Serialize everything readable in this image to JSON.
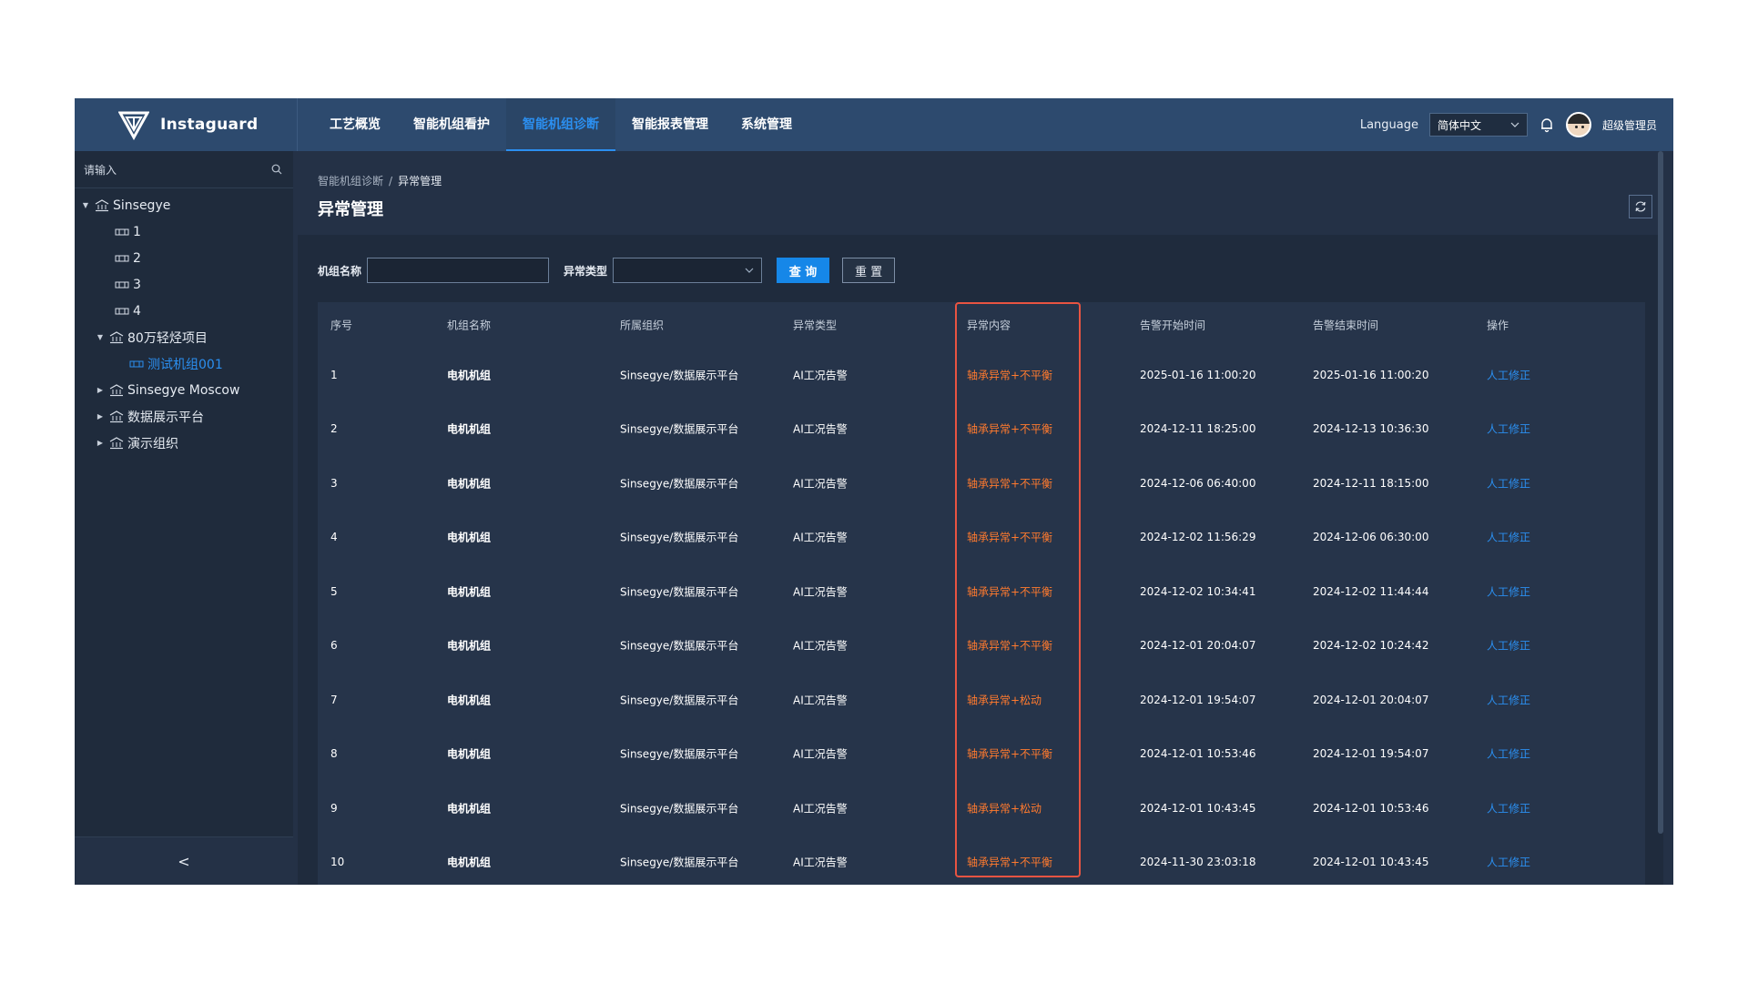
{
  "app": {
    "brand": "Instaguard"
  },
  "nav": {
    "items": [
      {
        "label": "工艺概览",
        "active": false
      },
      {
        "label": "智能机组看护",
        "active": false
      },
      {
        "label": "智能机组诊断",
        "active": true
      },
      {
        "label": "智能报表管理",
        "active": false
      },
      {
        "label": "系统管理",
        "active": false
      }
    ]
  },
  "header_tools": {
    "language_label": "Language",
    "language_value": "简体中文",
    "user_name": "超级管理员"
  },
  "sidebar": {
    "search_placeholder": "请输入",
    "tree": [
      {
        "label": "Sinsegye",
        "type": "org",
        "expanded": true
      },
      {
        "label": "1",
        "type": "unit"
      },
      {
        "label": "2",
        "type": "unit"
      },
      {
        "label": "3",
        "type": "unit"
      },
      {
        "label": "4",
        "type": "unit"
      },
      {
        "label": "80万轻烃项目",
        "type": "org",
        "expanded": true
      },
      {
        "label": "测试机组001",
        "type": "unit",
        "selected": true
      },
      {
        "label": "Sinsegye Moscow",
        "type": "org",
        "expanded": false
      },
      {
        "label": "数据展示平台",
        "type": "org",
        "expanded": false
      },
      {
        "label": "演示组织",
        "type": "org",
        "expanded": false
      }
    ],
    "collapse_glyph": "<"
  },
  "page": {
    "breadcrumb": [
      "智能机组诊断",
      "异常管理"
    ],
    "breadcrumb_sep": "/",
    "title": "异常管理"
  },
  "filters": {
    "unit_name_label": "机组名称",
    "unit_name_value": "",
    "anomaly_type_label": "异常类型",
    "anomaly_type_value": "",
    "query_label": "查 询",
    "reset_label": "重 置"
  },
  "table": {
    "columns": [
      "序号",
      "机组名称",
      "所属组织",
      "异常类型",
      "异常内容",
      "告警开始时间",
      "告警结束时间",
      "操作"
    ],
    "rows": [
      [
        "1",
        "电机机组",
        "Sinsegye/数据展示平台",
        "AI工况告警",
        "轴承异常+不平衡",
        "2025-01-16 11:00:20",
        "2025-01-16 11:00:20",
        "人工修正"
      ],
      [
        "2",
        "电机机组",
        "Sinsegye/数据展示平台",
        "AI工况告警",
        "轴承异常+不平衡",
        "2024-12-11 18:25:00",
        "2024-12-13 10:36:30",
        "人工修正"
      ],
      [
        "3",
        "电机机组",
        "Sinsegye/数据展示平台",
        "AI工况告警",
        "轴承异常+不平衡",
        "2024-12-06 06:40:00",
        "2024-12-11 18:15:00",
        "人工修正"
      ],
      [
        "4",
        "电机机组",
        "Sinsegye/数据展示平台",
        "AI工况告警",
        "轴承异常+不平衡",
        "2024-12-02 11:56:29",
        "2024-12-06 06:30:00",
        "人工修正"
      ],
      [
        "5",
        "电机机组",
        "Sinsegye/数据展示平台",
        "AI工况告警",
        "轴承异常+不平衡",
        "2024-12-02 10:34:41",
        "2024-12-02 11:44:44",
        "人工修正"
      ],
      [
        "6",
        "电机机组",
        "Sinsegye/数据展示平台",
        "AI工况告警",
        "轴承异常+不平衡",
        "2024-12-01 20:04:07",
        "2024-12-02 10:24:42",
        "人工修正"
      ],
      [
        "7",
        "电机机组",
        "Sinsegye/数据展示平台",
        "AI工况告警",
        "轴承异常+松动",
        "2024-12-01 19:54:07",
        "2024-12-01 20:04:07",
        "人工修正"
      ],
      [
        "8",
        "电机机组",
        "Sinsegye/数据展示平台",
        "AI工况告警",
        "轴承异常+不平衡",
        "2024-12-01 10:53:46",
        "2024-12-01 19:54:07",
        "人工修正"
      ],
      [
        "9",
        "电机机组",
        "Sinsegye/数据展示平台",
        "AI工况告警",
        "轴承异常+松动",
        "2024-12-01 10:43:45",
        "2024-12-01 10:53:46",
        "人工修正"
      ],
      [
        "10",
        "电机机组",
        "Sinsegye/数据展示平台",
        "AI工况告警",
        "轴承异常+不平衡",
        "2024-11-30 23:03:18",
        "2024-12-01 10:43:45",
        "人工修正"
      ]
    ]
  },
  "colors": {
    "accent": "#2b8ff0",
    "anomaly_text": "#ff7a2e",
    "highlight_border": "#e85442",
    "topbar": "#2d4a6e",
    "sidebar": "#1f2b3c"
  }
}
